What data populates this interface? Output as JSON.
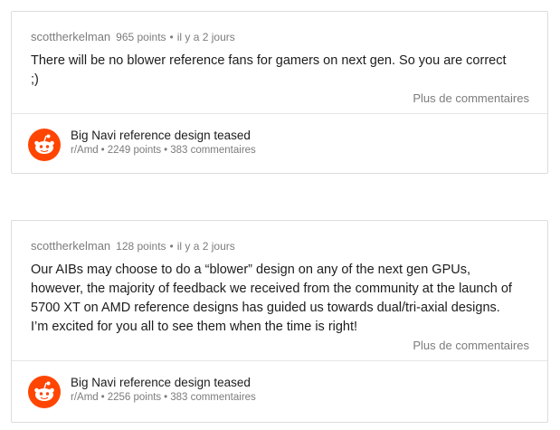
{
  "comments": [
    {
      "author": "scottherkelman",
      "points": "965 points",
      "time": "il y a 2 jours",
      "lines": [
        "There will be no blower reference fans for gamers on next gen. So you are correct",
        ";)"
      ],
      "more": "Plus de commentaires",
      "post": {
        "title": "Big Navi reference design teased",
        "subreddit": "r/Amd",
        "points": "2249 points",
        "comments": "383 commentaires"
      }
    },
    {
      "author": "scottherkelman",
      "points": "128 points",
      "time": "il y a 2 jours",
      "lines": [
        "Our AIBs may choose to do a “blower” design on any of the next gen GPUs,",
        "however, the majority of feedback we received from the community at the launch of",
        "5700 XT on AMD reference designs has guided us towards dual/tri-axial designs.",
        "I’m excited for you all to see them when the time is right!"
      ],
      "more": "Plus de commentaires",
      "post": {
        "title": "Big Navi reference design teased",
        "subreddit": "r/Amd",
        "points": "2256 points",
        "comments": "383 commentaires"
      }
    }
  ],
  "separator": "•",
  "colors": {
    "reddit_orange": "#ff4500",
    "meta_gray": "#7c7c7c",
    "border": "#dcdcdc"
  },
  "icons": {
    "avatar": "reddit-snoo-icon"
  }
}
